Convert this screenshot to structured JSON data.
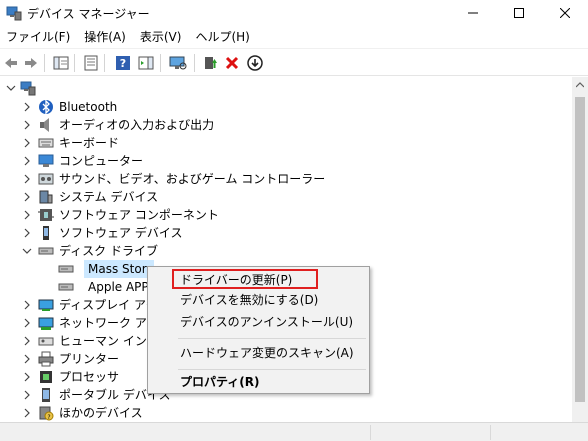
{
  "window": {
    "title": "デバイス マネージャー",
    "minimize_glyph": "—",
    "maximize_glyph": "☐",
    "close_glyph": "✕"
  },
  "menu": [
    {
      "label": "ファイル(F)"
    },
    {
      "label": "操作(A)"
    },
    {
      "label": "表示(V)"
    },
    {
      "label": "ヘルプ(H)"
    }
  ],
  "toolbar": {
    "buttons": [
      "back-icon",
      "forward-icon",
      "show-hide-tree-icon",
      "properties-icon",
      "help-icon",
      "action-pane-icon",
      "scan-hardware-icon",
      "update-driver-icon",
      "uninstall-icon",
      "disable-device-icon"
    ]
  },
  "tree": {
    "root_label": "",
    "items": [
      {
        "label": "Bluetooth",
        "icon": "bluetooth-icon",
        "expanded": false
      },
      {
        "label": "オーディオの入力および出力",
        "icon": "speaker-icon",
        "expanded": false
      },
      {
        "label": "キーボード",
        "icon": "keyboard-icon",
        "expanded": false
      },
      {
        "label": "コンピューター",
        "icon": "computer-icon",
        "expanded": false
      },
      {
        "label": "サウンド、ビデオ、およびゲーム コントローラー",
        "icon": "sound-icon",
        "expanded": false
      },
      {
        "label": "システム デバイス",
        "icon": "system-device-icon",
        "expanded": false
      },
      {
        "label": "ソフトウェア コンポーネント",
        "icon": "software-component-icon",
        "expanded": false
      },
      {
        "label": "ソフトウェア デバイス",
        "icon": "software-device-icon",
        "expanded": false
      },
      {
        "label": "ディスク ドライブ",
        "icon": "disk-drive-icon",
        "expanded": true
      },
      {
        "label": "Mass Stora",
        "icon": "disk-icon",
        "child": true,
        "selected": true
      },
      {
        "label": "Apple APPLE",
        "icon": "disk-icon",
        "child": true
      },
      {
        "label": "ディスプレイ アダプタ",
        "icon": "display-adapter-icon",
        "expanded": false
      },
      {
        "label": "ネットワーク アダプタ",
        "icon": "network-adapter-icon",
        "expanded": false
      },
      {
        "label": "ヒューマン インターフ",
        "icon": "hid-icon",
        "expanded": false
      },
      {
        "label": "プリンター",
        "icon": "printer-icon",
        "expanded": false
      },
      {
        "label": "プロセッサ",
        "icon": "processor-icon",
        "expanded": false
      },
      {
        "label": "ポータブル デバイス",
        "icon": "portable-device-icon",
        "expanded": false
      },
      {
        "label": "ほかのデバイス",
        "icon": "other-device-icon",
        "expanded": false
      }
    ]
  },
  "context_menu": {
    "items": [
      {
        "label": "ドライバーの更新(P)",
        "highlighted": true
      },
      {
        "label": "デバイスを無効にする(D)"
      },
      {
        "label": "デバイスのアンインストール(U)"
      },
      {
        "label": "ハードウェア変更のスキャン(A)"
      },
      {
        "label": "プロパティ(R)",
        "bold": true
      }
    ]
  },
  "colors": {
    "highlight_border": "#e02020",
    "selection": "#cce8ff",
    "menu_bg": "#f2f2f2"
  }
}
